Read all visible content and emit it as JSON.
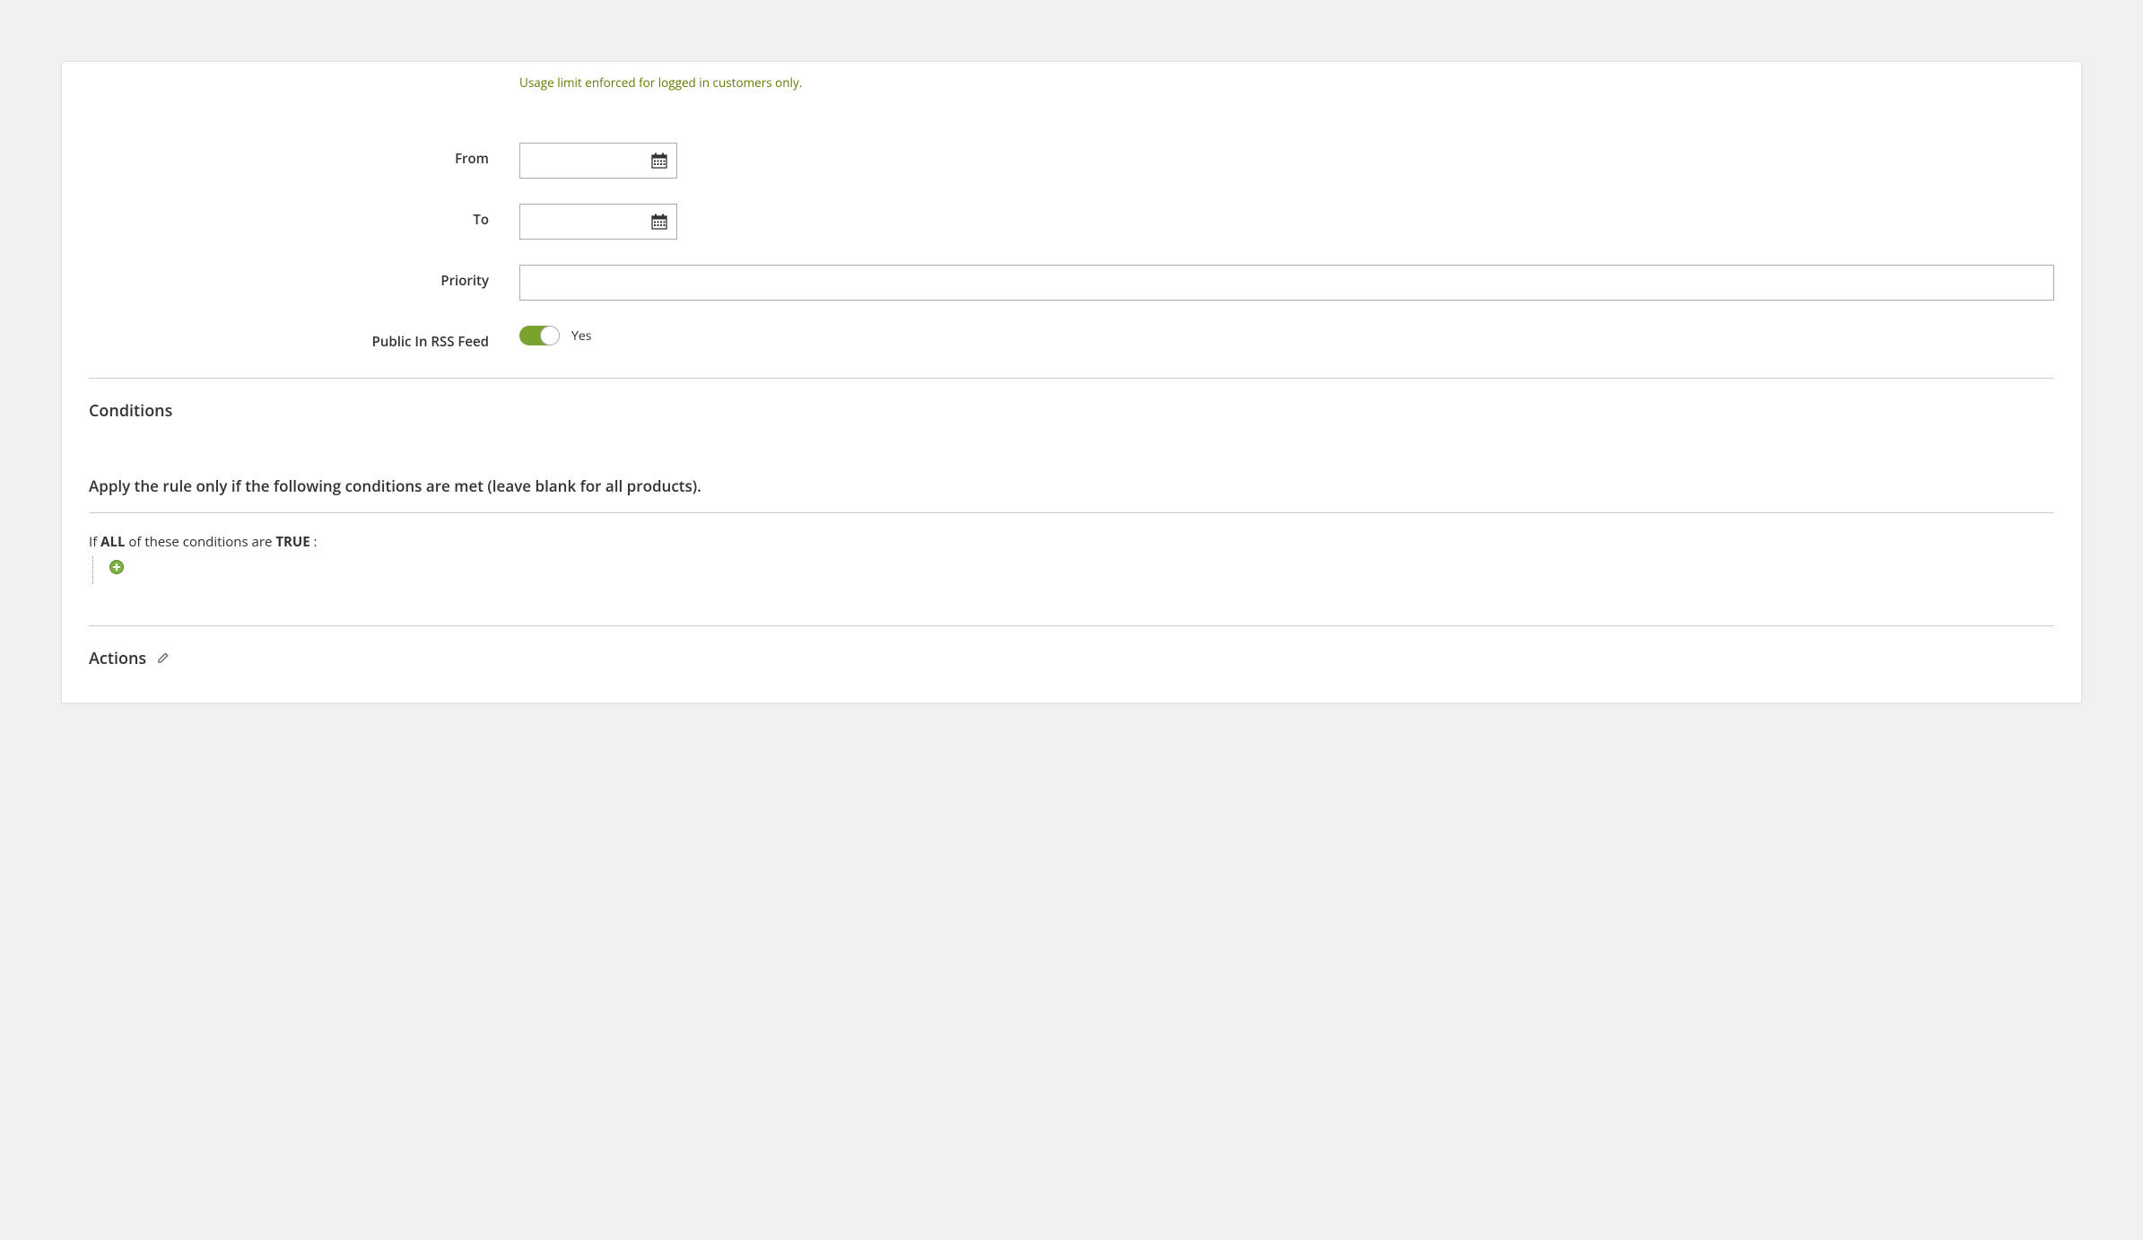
{
  "note": "Usage limit enforced for logged in customers only.",
  "fields": {
    "from": {
      "label": "From",
      "value": ""
    },
    "to": {
      "label": "To",
      "value": ""
    },
    "priority": {
      "label": "Priority",
      "value": ""
    },
    "rss": {
      "label": "Public In RSS Feed",
      "value_text": "Yes"
    }
  },
  "conditions": {
    "title": "Conditions",
    "intro": "Apply the rule only if the following conditions are met (leave blank for all products).",
    "sentence": {
      "pre": "If ",
      "aggregator": "ALL",
      "mid": " of these conditions are ",
      "value": "TRUE",
      "post": " :"
    }
  },
  "actions": {
    "title": "Actions"
  }
}
